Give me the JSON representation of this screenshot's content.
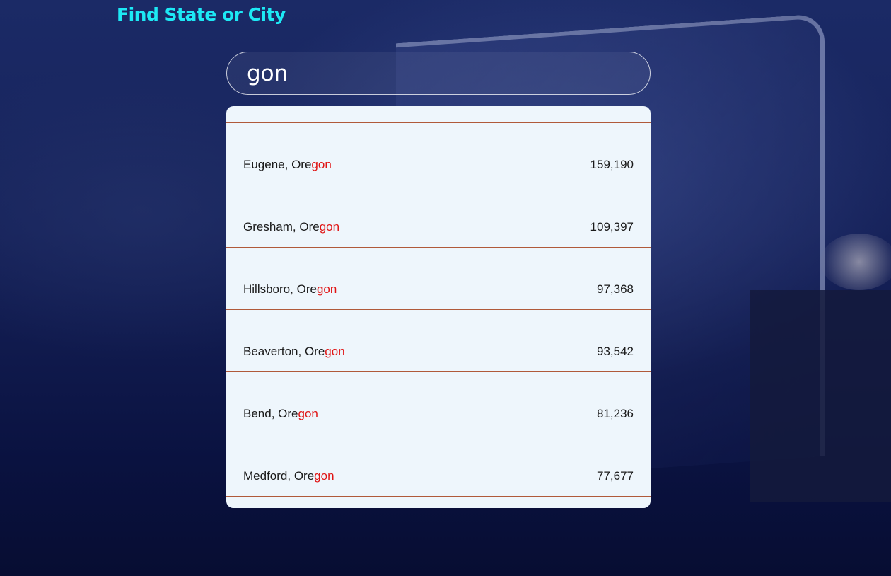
{
  "header": {
    "title": "Find State or City"
  },
  "search": {
    "value": "gon"
  },
  "results": [
    {
      "city": "Eugene",
      "state_prefix": "Ore",
      "state_match": "gon",
      "population": "159,190"
    },
    {
      "city": "Gresham",
      "state_prefix": "Ore",
      "state_match": "gon",
      "population": "109,397"
    },
    {
      "city": "Hillsboro",
      "state_prefix": "Ore",
      "state_match": "gon",
      "population": "97,368"
    },
    {
      "city": "Beaverton",
      "state_prefix": "Ore",
      "state_match": "gon",
      "population": "93,542"
    },
    {
      "city": "Bend",
      "state_prefix": "Ore",
      "state_match": "gon",
      "population": "81,236"
    },
    {
      "city": "Medford",
      "state_prefix": "Ore",
      "state_match": "gon",
      "population": "77,677"
    }
  ],
  "colors": {
    "title": "#1de9f5",
    "highlight": "#e01414",
    "list_bg": "#eef6fc",
    "divider": "#b05a3a"
  }
}
